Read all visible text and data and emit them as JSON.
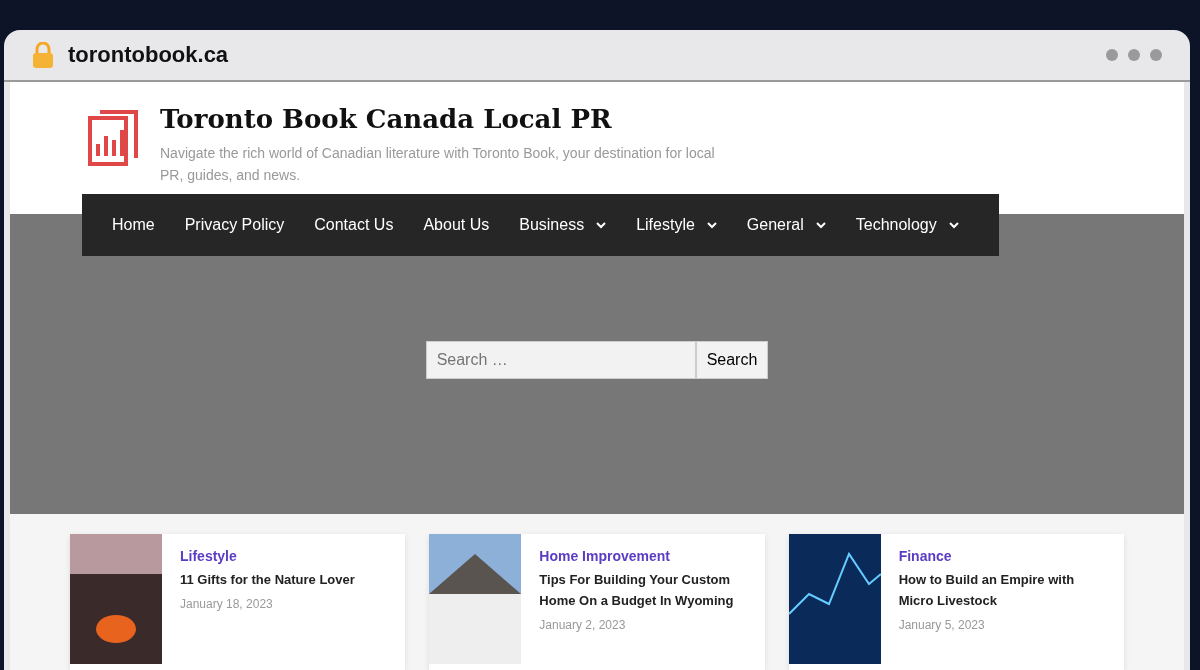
{
  "browser": {
    "url": "torontobook.ca"
  },
  "site": {
    "title": "Toronto Book Canada Local PR",
    "tagline": "Navigate the rich world of Canadian literature with Toronto Book, your destination for local PR, guides, and news."
  },
  "nav": [
    {
      "label": "Home",
      "dropdown": false
    },
    {
      "label": "Privacy Policy",
      "dropdown": false
    },
    {
      "label": "Contact Us",
      "dropdown": false
    },
    {
      "label": "About Us",
      "dropdown": false
    },
    {
      "label": "Business",
      "dropdown": true
    },
    {
      "label": "Lifestyle",
      "dropdown": true
    },
    {
      "label": "General",
      "dropdown": true
    },
    {
      "label": "Technology",
      "dropdown": true
    }
  ],
  "search": {
    "placeholder": "Search …",
    "button": "Search"
  },
  "posts": [
    {
      "kind": "campfire",
      "category": "Lifestyle",
      "title": "11 Gifts for the Nature Lover",
      "date": "January 18, 2023"
    },
    {
      "kind": "house",
      "category": "Home Improvement",
      "title": "Tips For Building Your Custom Home On a Budget In Wyoming",
      "date": "January 2, 2023"
    },
    {
      "kind": "chart",
      "category": "Finance",
      "title": "How to Build an Empire with Micro Livestock",
      "date": "January 5, 2023"
    }
  ]
}
